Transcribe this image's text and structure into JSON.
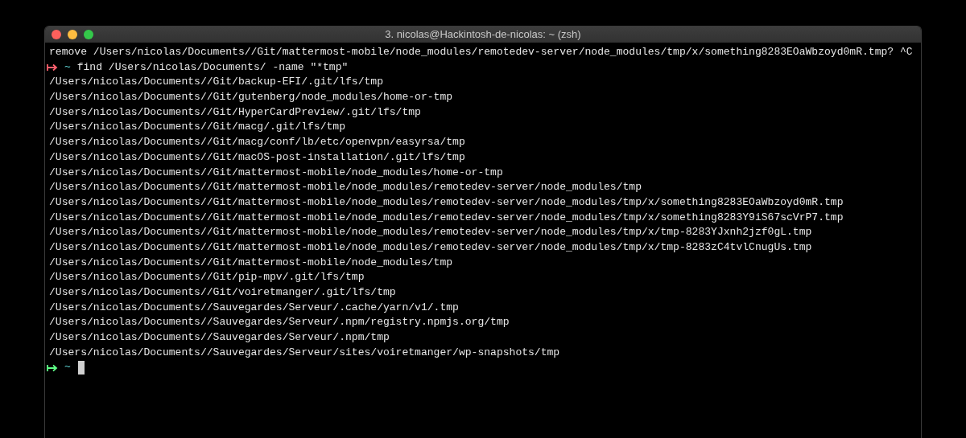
{
  "window": {
    "title": "3. nicolas@Hackintosh-de-nicolas: ~ (zsh)"
  },
  "lines": [
    {
      "kind": "output",
      "text": "remove /Users/nicolas/Documents//Git/mattermost-mobile/node_modules/remotedev-server/node_modules/tmp/x/something8283EOaWbzoyd0mR.tmp? ^C"
    },
    {
      "kind": "prompt",
      "failed": true,
      "dir": "~",
      "command": "find /Users/nicolas/Documents/ -name \"*tmp\"",
      "cursor": false
    },
    {
      "kind": "output",
      "text": "/Users/nicolas/Documents//Git/backup-EFI/.git/lfs/tmp"
    },
    {
      "kind": "output",
      "text": "/Users/nicolas/Documents//Git/gutenberg/node_modules/home-or-tmp"
    },
    {
      "kind": "output",
      "text": "/Users/nicolas/Documents//Git/HyperCardPreview/.git/lfs/tmp"
    },
    {
      "kind": "output",
      "text": "/Users/nicolas/Documents//Git/macg/.git/lfs/tmp"
    },
    {
      "kind": "output",
      "text": "/Users/nicolas/Documents//Git/macg/conf/lb/etc/openvpn/easyrsa/tmp"
    },
    {
      "kind": "output",
      "text": "/Users/nicolas/Documents//Git/macOS-post-installation/.git/lfs/tmp"
    },
    {
      "kind": "output",
      "text": "/Users/nicolas/Documents//Git/mattermost-mobile/node_modules/home-or-tmp"
    },
    {
      "kind": "output",
      "text": "/Users/nicolas/Documents//Git/mattermost-mobile/node_modules/remotedev-server/node_modules/tmp"
    },
    {
      "kind": "output",
      "text": "/Users/nicolas/Documents//Git/mattermost-mobile/node_modules/remotedev-server/node_modules/tmp/x/something8283EOaWbzoyd0mR.tmp"
    },
    {
      "kind": "output",
      "text": "/Users/nicolas/Documents//Git/mattermost-mobile/node_modules/remotedev-server/node_modules/tmp/x/something8283Y9iS67scVrP7.tmp"
    },
    {
      "kind": "output",
      "text": "/Users/nicolas/Documents//Git/mattermost-mobile/node_modules/remotedev-server/node_modules/tmp/x/tmp-8283YJxnh2jzf0gL.tmp"
    },
    {
      "kind": "output",
      "text": "/Users/nicolas/Documents//Git/mattermost-mobile/node_modules/remotedev-server/node_modules/tmp/x/tmp-8283zC4tvlCnugUs.tmp"
    },
    {
      "kind": "output",
      "text": "/Users/nicolas/Documents//Git/mattermost-mobile/node_modules/tmp"
    },
    {
      "kind": "output",
      "text": "/Users/nicolas/Documents//Git/pip-mpv/.git/lfs/tmp"
    },
    {
      "kind": "output",
      "text": "/Users/nicolas/Documents//Git/voiretmanger/.git/lfs/tmp"
    },
    {
      "kind": "output",
      "text": "/Users/nicolas/Documents//Sauvegardes/Serveur/.cache/yarn/v1/.tmp"
    },
    {
      "kind": "output",
      "text": "/Users/nicolas/Documents//Sauvegardes/Serveur/.npm/registry.npmjs.org/tmp"
    },
    {
      "kind": "output",
      "text": "/Users/nicolas/Documents//Sauvegardes/Serveur/.npm/tmp"
    },
    {
      "kind": "output",
      "text": "/Users/nicolas/Documents//Sauvegardes/Serveur/sites/voiretmanger/wp-snapshots/tmp"
    },
    {
      "kind": "prompt",
      "failed": false,
      "dir": "~",
      "cursor": true
    }
  ]
}
